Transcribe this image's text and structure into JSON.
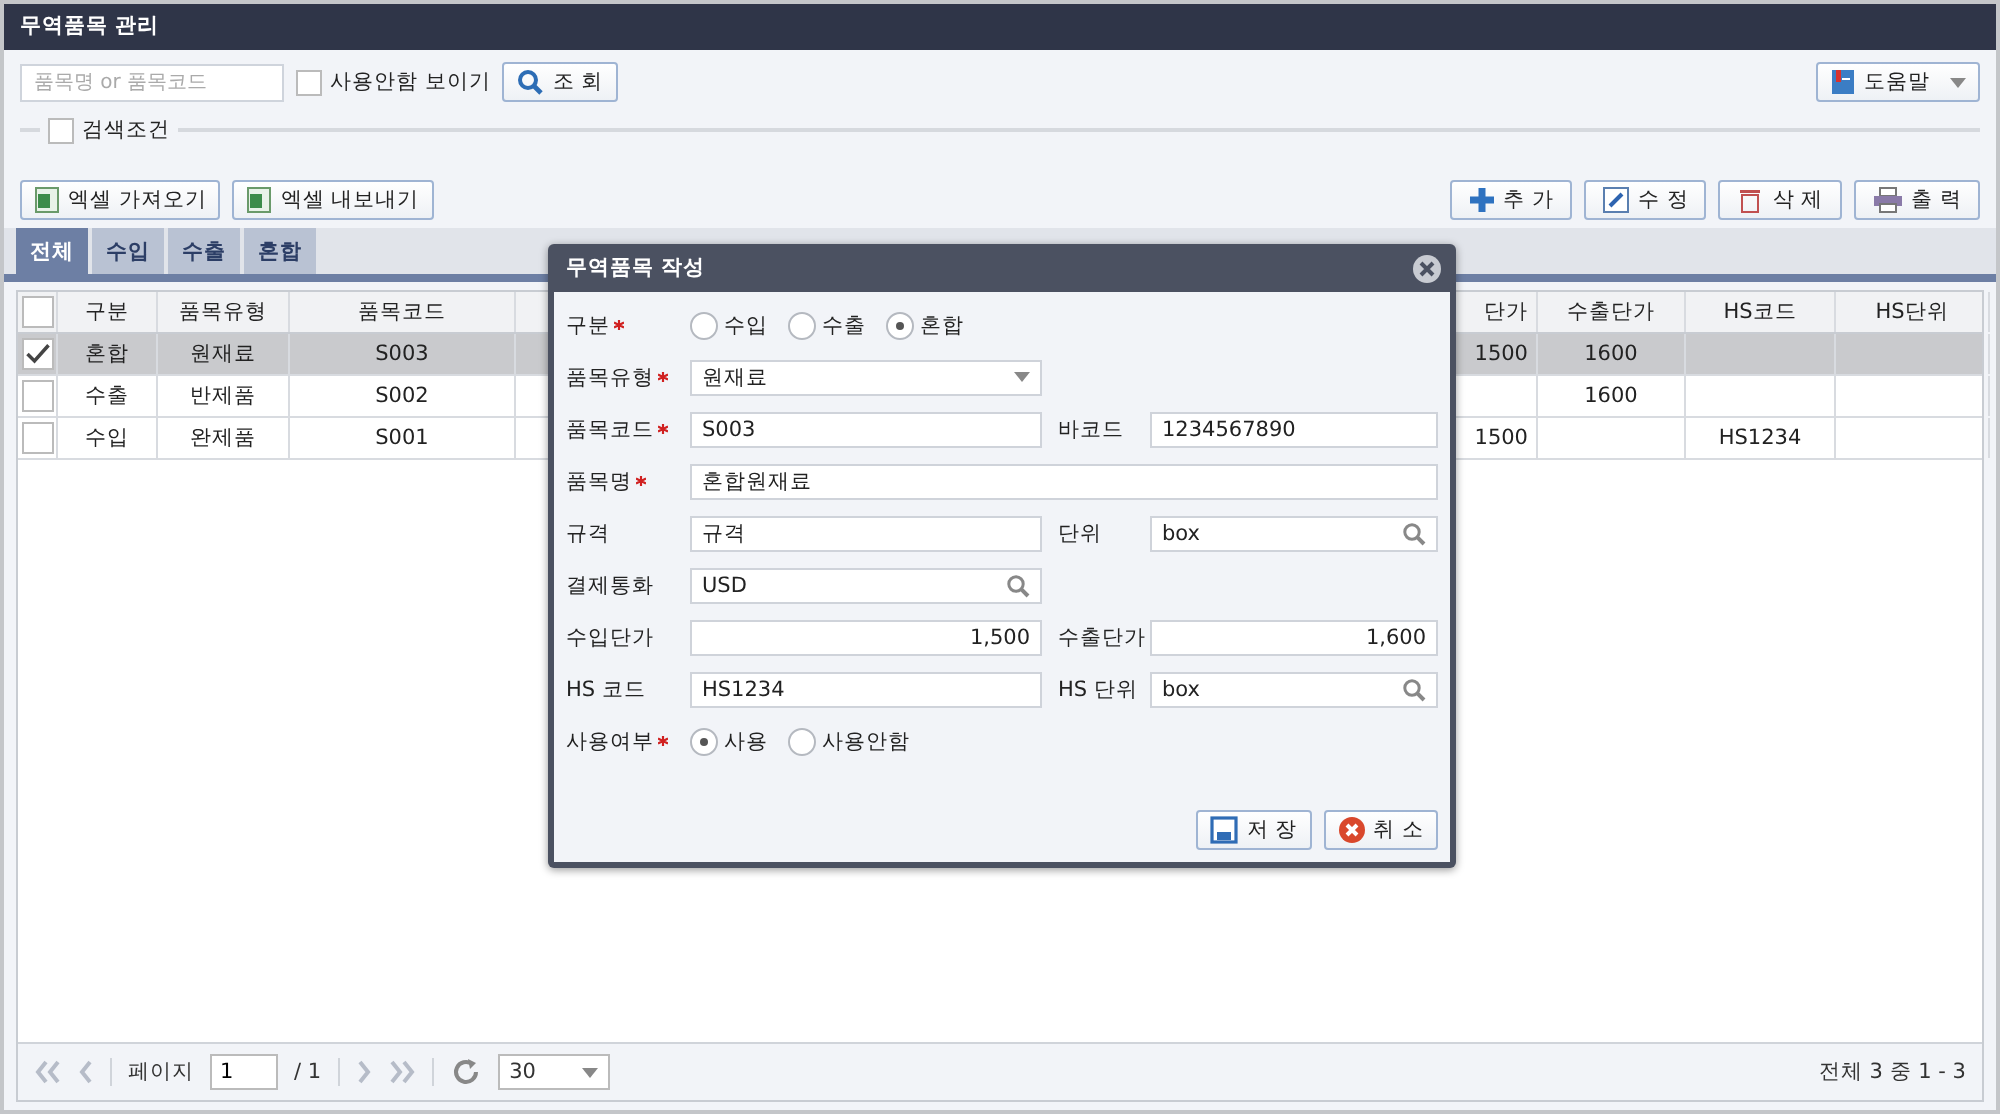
{
  "window": {
    "title": "무역품목 관리"
  },
  "search": {
    "placeholder": "품목명 or 품목코드",
    "show_unused": {
      "label": "사용안함 보이기",
      "checked": false
    },
    "button": "조 회"
  },
  "help_button": "도움말",
  "search_conditions": {
    "label": "검색조건",
    "checked": false
  },
  "excel_buttons": [
    "엑셀 가져오기",
    "엑셀 내보내기"
  ],
  "action_buttons": [
    {
      "kind": "add",
      "label": "추 가"
    },
    {
      "kind": "edit",
      "label": "수 정"
    },
    {
      "kind": "delete",
      "label": "삭 제"
    },
    {
      "kind": "print",
      "label": "출 력"
    }
  ],
  "tabs": [
    {
      "label": "전체",
      "selected": true
    },
    {
      "label": "수입",
      "selected": false
    },
    {
      "label": "수출",
      "selected": false
    },
    {
      "label": "혼합",
      "selected": false
    }
  ],
  "table": {
    "all_checked": false,
    "columns": [
      "구분",
      "품목유형",
      "품목코드",
      "단가",
      "수출단가",
      "HS코드",
      "HS단위"
    ],
    "rows": [
      {
        "checked": true,
        "selected": true,
        "cells": [
          "혼합",
          "원재료",
          "S003",
          "1500",
          "1600",
          "",
          ""
        ]
      },
      {
        "checked": false,
        "selected": false,
        "cells": [
          "수출",
          "반제품",
          "S002",
          "",
          "1600",
          "",
          ""
        ]
      },
      {
        "checked": false,
        "selected": false,
        "cells": [
          "수입",
          "완제품",
          "S001",
          "1500",
          "",
          "HS1234",
          ""
        ]
      }
    ]
  },
  "pager": {
    "page_label": "페이지",
    "page": "1",
    "total_pages": "/ 1",
    "page_size": "30",
    "summary": "전체 3 중 1 - 3"
  },
  "dialog": {
    "title": "무역품목 작성",
    "type": {
      "label": "구분",
      "required": true,
      "options": [
        {
          "label": "수입",
          "selected": false
        },
        {
          "label": "수출",
          "selected": false
        },
        {
          "label": "혼합",
          "selected": true
        }
      ]
    },
    "item_type": {
      "label": "품목유형",
      "required": true,
      "value": "원재료"
    },
    "item_code": {
      "label": "품목코드",
      "required": true,
      "value": "S003"
    },
    "barcode": {
      "label": "바코드",
      "value": "1234567890"
    },
    "item_name": {
      "label": "품목명",
      "required": true,
      "value": "혼합원재료"
    },
    "spec": {
      "label": "규격",
      "value": "규격"
    },
    "unit": {
      "label": "단위",
      "value": "box"
    },
    "currency": {
      "label": "결제통화",
      "value": "USD"
    },
    "import_price": {
      "label": "수입단가",
      "value": "1,500"
    },
    "export_price": {
      "label": "수출단가",
      "value": "1,600"
    },
    "hs_code": {
      "label": "HS 코드",
      "value": "HS1234"
    },
    "hs_unit": {
      "label": "HS 단위",
      "value": "box"
    },
    "in_use": {
      "label": "사용여부",
      "required": true,
      "options": [
        {
          "label": "사용",
          "selected": true
        },
        {
          "label": "사용안함",
          "selected": false
        }
      ]
    },
    "buttons": [
      {
        "kind": "save",
        "label": "저 장"
      },
      {
        "kind": "cancel",
        "label": "취 소"
      }
    ]
  }
}
